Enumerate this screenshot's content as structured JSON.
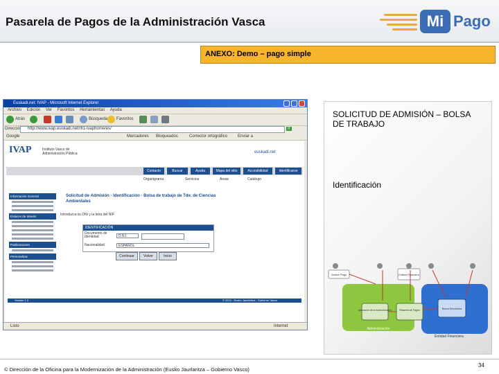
{
  "slide": {
    "title": "Pasarela de Pagos de la Administración Vasca",
    "annex": "ANEXO: Demo – pago simple",
    "heading": "SOLICITUD DE ADMISIÓN – BOLSA DE TRABAJO",
    "step_label": "Identificación",
    "footer": "© Dirección de la Oficina para la Modernización de la Administración (Eusko Jaurlaritza – Gobierno Vasco)",
    "page_number": "34"
  },
  "logo": {
    "mi": "Mi",
    "pago": "Pago",
    "accent": "#3b6db5",
    "lines_color": "#e8a84a"
  },
  "browser": {
    "window_title": "Euskadi.net: IVAP - Microsoft Internet Explorer",
    "menu": [
      "Archivo",
      "Edición",
      "Ver",
      "Favoritos",
      "Herramientas",
      "Ayuda"
    ],
    "toolbar": {
      "back": "Atrás",
      "search": "Búsqueda",
      "favorites": "Favoritos"
    },
    "address_label": "Dirección",
    "address": "http://www.ivap.euskadi.net/r61-ivaphome/es/",
    "links": [
      "Google",
      "Marcadores",
      "Bloqueados",
      "Corrector ortográfico",
      "Enviar a"
    ],
    "status_left": "Listo",
    "status_right": "Internet"
  },
  "ivap_page": {
    "org": "IVAP",
    "org_full": "Instituto Vasco de Administración Pública",
    "portal": "euskadi.net",
    "nav": [
      "Contacto",
      "Buscar",
      "Ayuda",
      "Mapa del sitio",
      "Accesibilidad",
      "Identificarse"
    ],
    "subnav": [
      "Organigrama",
      "Servicios",
      "Áreas",
      "Catálogo"
    ],
    "sidebar": [
      "Información General",
      "Enlaces de Interés",
      "Publicaciones",
      "Personalizar"
    ],
    "form_title": "Solicitud de Admisión - Identificación - Bolsa de trabajo de Tde. de Ciencias Ambientales",
    "instruction": "Introduzca su DNI y la letra del NIF",
    "section": "IDENTIFICACIÓN",
    "fields": [
      {
        "label": "Documento de Identidad",
        "value": "D.N.I"
      },
      {
        "label": "Nacionalidad",
        "value": "ESPAÑOL"
      }
    ],
    "buttons": [
      "Continuar",
      "Volver",
      "Inicio"
    ],
    "footer_left": "Versión 1.0",
    "footer_right": "© 2010 - Eusko Jaurlaritza - Gobierno Vasco"
  },
  "diagram": {
    "nodes": [
      "Gestor Pago",
      "Aplicación de la Administración",
      "Pasarela de Pagos",
      "Entidad Financiera",
      "Banca Electrónica"
    ],
    "areas": [
      "Administración",
      "Entidad Financiera"
    ],
    "colors": {
      "admin": "#8dc63f",
      "bank": "#2f6fd0",
      "arrow": "#c0392b"
    }
  }
}
